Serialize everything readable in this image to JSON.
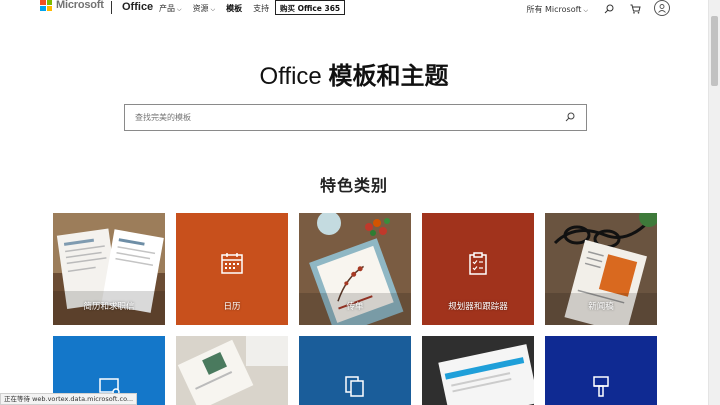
{
  "header": {
    "brand": "Microsoft",
    "product": "Office",
    "nav": [
      {
        "label": "产品",
        "dropdown": true
      },
      {
        "label": "资源",
        "dropdown": true
      },
      {
        "label": "模板",
        "dropdown": false,
        "active": true
      },
      {
        "label": "支持",
        "dropdown": false
      }
    ],
    "buy_button": "购买 Office 365",
    "all_microsoft": "所有 Microsoft",
    "colors": {
      "red": "#f25022",
      "green": "#7fba00",
      "blue": "#00a4ef",
      "yellow": "#ffb900"
    }
  },
  "hero": {
    "title_part1": "Office",
    "title_part2": "模板和主题"
  },
  "search": {
    "placeholder": "查找完美的模板"
  },
  "section": {
    "title": "特色类别"
  },
  "categories": [
    {
      "label": "简历和求职信",
      "color": "#b0a48e",
      "icon": "resume-photo"
    },
    {
      "label": "日历",
      "color": "#c8501c",
      "icon": "calendar-icon"
    },
    {
      "label": "传单",
      "color": "#8a6d4f",
      "icon": "flyer-photo"
    },
    {
      "label": "规划器和跟踪器",
      "color": "#a1331c",
      "icon": "clipboard-icon"
    },
    {
      "label": "新闻稿",
      "color": "#6d5a4a",
      "icon": "newsletter-photo"
    }
  ],
  "categories_row2": [
    {
      "color": "#1477c9",
      "icon": "presentation-icon"
    },
    {
      "color": "#d8d2c7",
      "icon": "stationery-photo"
    },
    {
      "color": "#1a5d9a",
      "icon": "copy-icon"
    },
    {
      "color": "#3b3b3b",
      "icon": "invoice-photo"
    },
    {
      "color": "#0f2a92",
      "icon": "paint-brush-icon"
    }
  ],
  "status_bar": "正在等待 web.vortex.data.microsoft.co..."
}
